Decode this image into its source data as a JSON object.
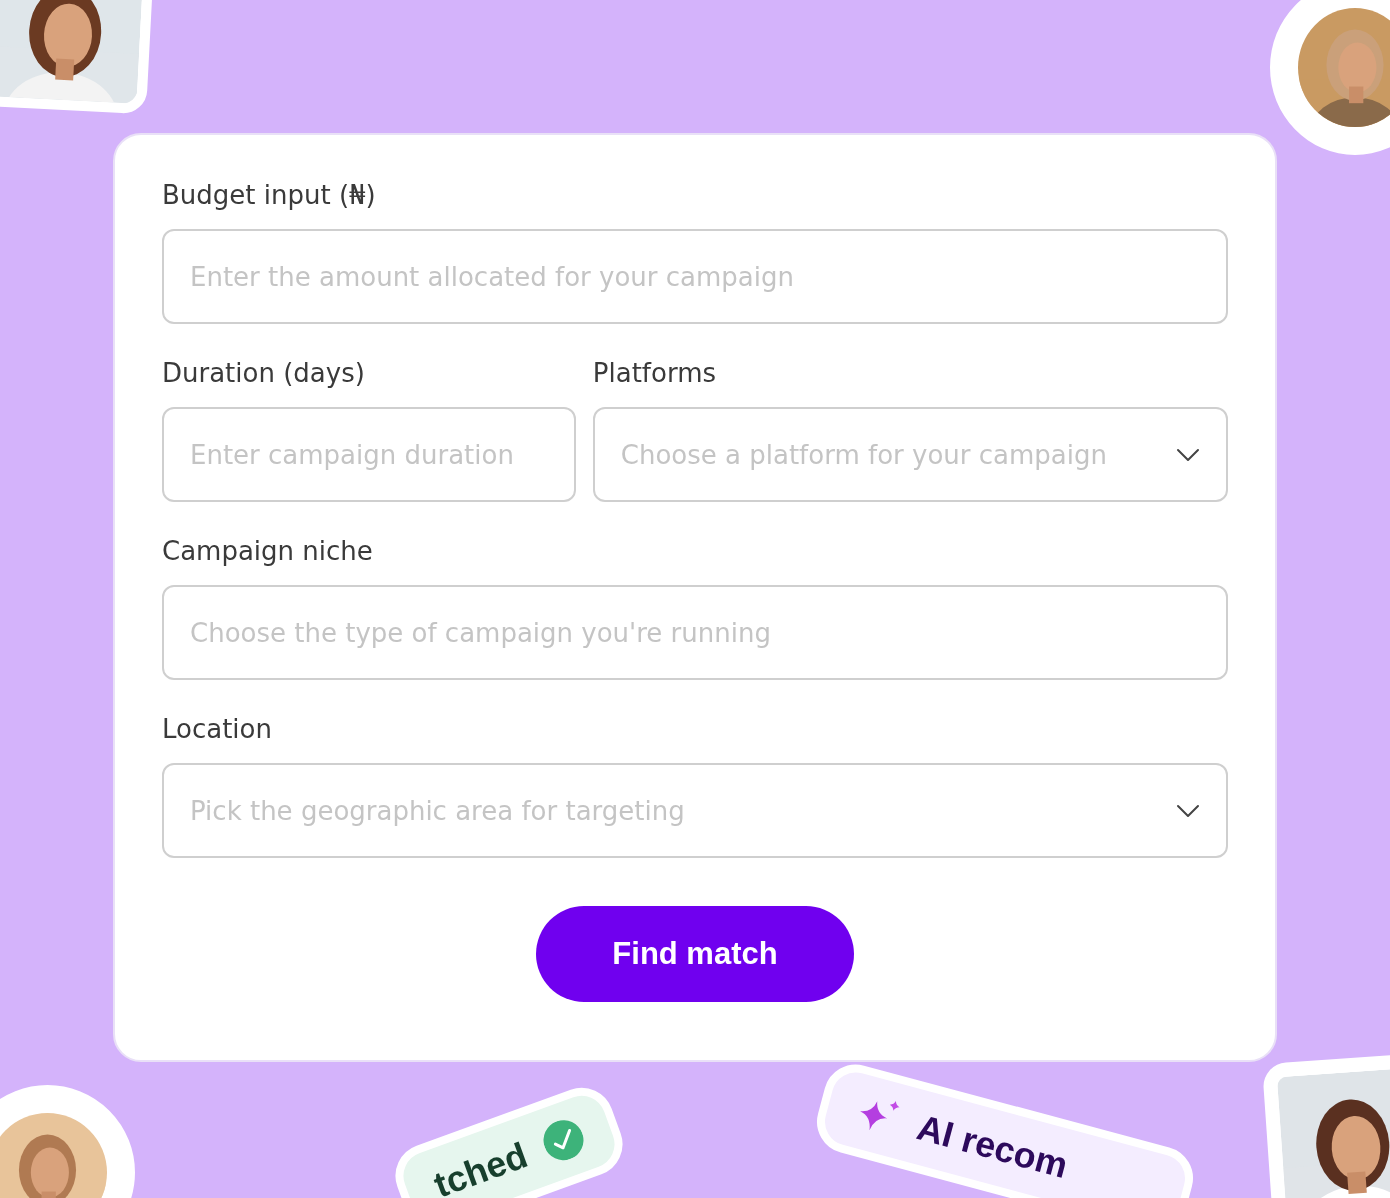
{
  "form": {
    "rows": [
      [
        {
          "label": "Budget input (₦)",
          "placeholder": "Enter the amount allocated for your campaign",
          "kind": "text"
        }
      ],
      [
        {
          "label": "Duration (days)",
          "placeholder": "Enter campaign duration",
          "kind": "text"
        },
        {
          "label": "Platforms",
          "placeholder": "Choose a platform for your campaign",
          "kind": "select"
        }
      ],
      [
        {
          "label": "Campaign niche",
          "placeholder": "Choose the type of campaign you're running",
          "kind": "text"
        }
      ],
      [
        {
          "label": "Location",
          "placeholder": "Pick the geographic area for targeting",
          "kind": "select"
        }
      ]
    ],
    "submit": "Find match"
  },
  "badges": [
    {
      "text": "tched",
      "kind": "matched"
    },
    {
      "text": "AI recom",
      "kind": "ai"
    }
  ]
}
